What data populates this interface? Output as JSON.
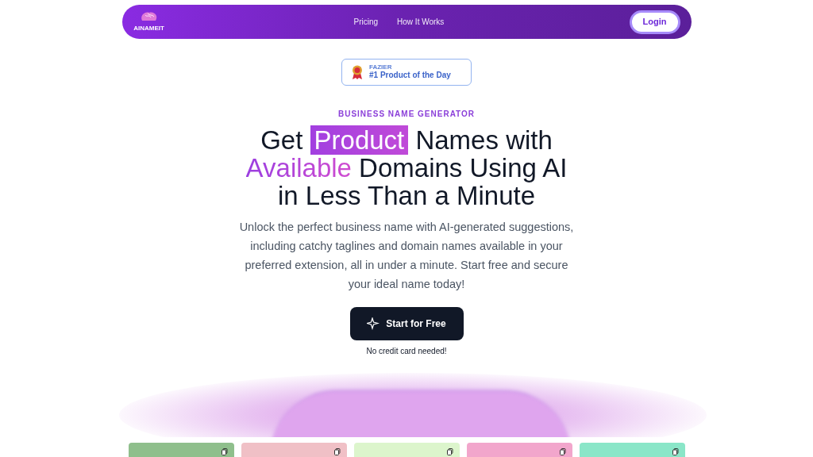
{
  "nav": {
    "logo_text": "AINAMEIT",
    "links": [
      "Pricing",
      "How It Works"
    ],
    "login": "Login"
  },
  "badge": {
    "source": "FAZIER",
    "title": "#1 Product of the Day"
  },
  "eyebrow": "BUSINESS NAME GENERATOR",
  "headline": [
    {
      "kind": "plain",
      "text": "Get "
    },
    {
      "kind": "highlight",
      "text": "Product"
    },
    {
      "kind": "plain",
      "text": " Names with "
    },
    {
      "kind": "gradient",
      "text": "Available"
    },
    {
      "kind": "plain",
      "text": " Domains Using AI in Less Than a Minute"
    }
  ],
  "description": "Unlock the perfect business name with AI-generated suggestions, including catchy taglines and domain names available in your preferred extension, all in under a minute. Start free and secure your ideal name today!",
  "cta": "Start for Free",
  "cta_note": "No credit card needed!",
  "cards": [
    {
      "color": "#8fbf8c"
    },
    {
      "color": "#f0c0c6"
    },
    {
      "color": "#dcf5cc"
    },
    {
      "color": "#f2a6cc"
    },
    {
      "color": "#8ae6c8"
    }
  ]
}
